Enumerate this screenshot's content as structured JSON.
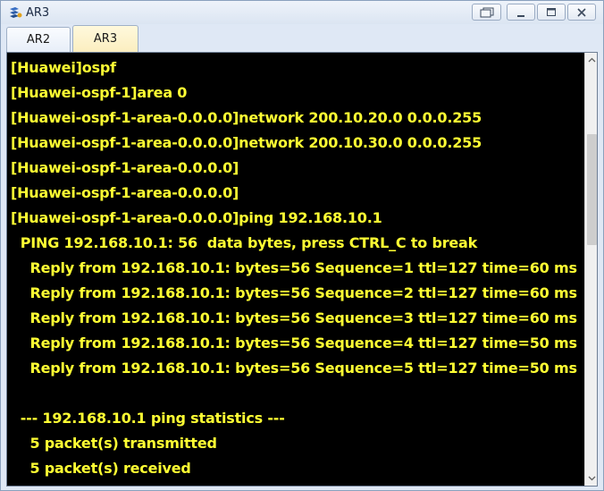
{
  "window": {
    "title": "AR3",
    "app_icon": "ensp-router-icon",
    "controls": [
      "restore-icon",
      "minimize-icon",
      "maximize-icon",
      "close-icon"
    ]
  },
  "tabs": [
    {
      "label": "AR2",
      "active": false
    },
    {
      "label": "AR3",
      "active": true
    }
  ],
  "terminal": {
    "text_color": "#ffff33",
    "background": "#000000",
    "lines": [
      "[Huawei]ospf",
      "[Huawei-ospf-1]area 0",
      "[Huawei-ospf-1-area-0.0.0.0]network 200.10.20.0 0.0.0.255",
      "[Huawei-ospf-1-area-0.0.0.0]network 200.10.30.0 0.0.0.255",
      "[Huawei-ospf-1-area-0.0.0.0]",
      "[Huawei-ospf-1-area-0.0.0.0]",
      "[Huawei-ospf-1-area-0.0.0.0]ping 192.168.10.1",
      "  PING 192.168.10.1: 56  data bytes, press CTRL_C to break",
      "    Reply from 192.168.10.1: bytes=56 Sequence=1 ttl=127 time=60 ms",
      "    Reply from 192.168.10.1: bytes=56 Sequence=2 ttl=127 time=60 ms",
      "    Reply from 192.168.10.1: bytes=56 Sequence=3 ttl=127 time=60 ms",
      "    Reply from 192.168.10.1: bytes=56 Sequence=4 ttl=127 time=50 ms",
      "    Reply from 192.168.10.1: bytes=56 Sequence=5 ttl=127 time=50 ms",
      "",
      "  --- 192.168.10.1 ping statistics ---",
      "    5 packet(s) transmitted",
      "    5 packet(s) received"
    ]
  },
  "scrollbar": {
    "position_fraction": 0.23
  }
}
